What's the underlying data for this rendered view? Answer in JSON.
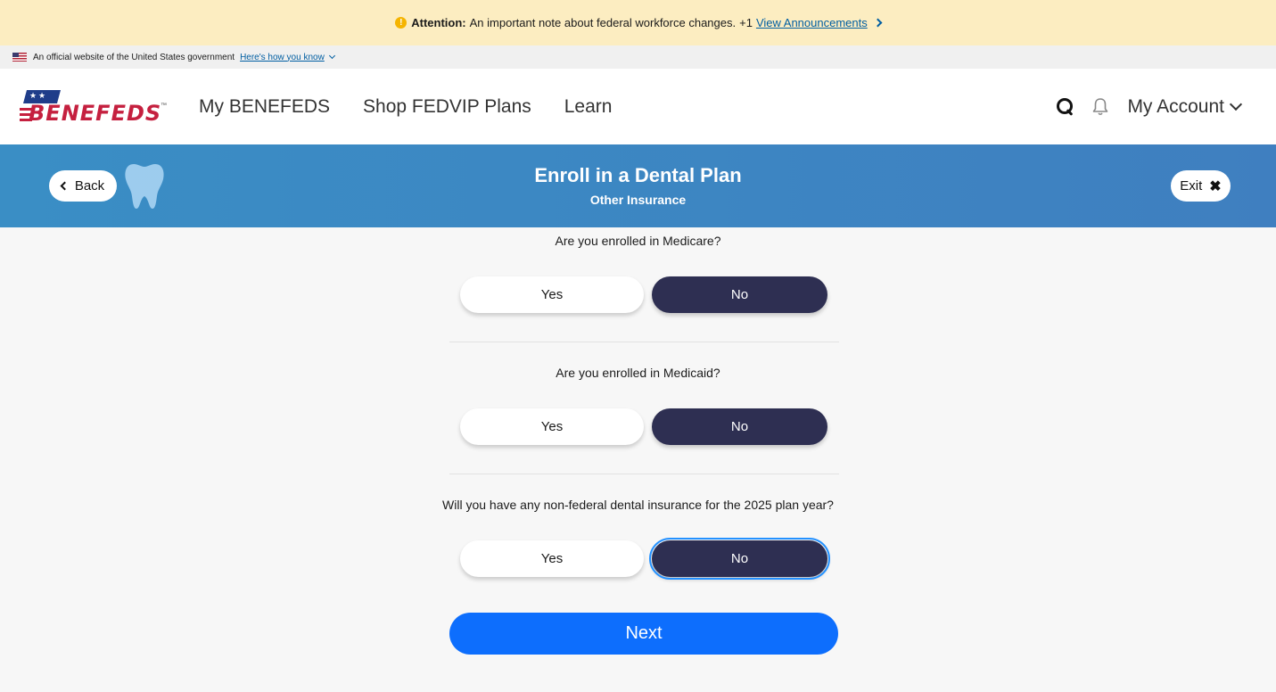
{
  "attention": {
    "label": "Attention:",
    "message": "An important note about federal workforce changes.",
    "count": "+1",
    "link_label": "View Announcements"
  },
  "gov_banner": {
    "text": "An official website of the United States government",
    "link_label": "Here's how you know"
  },
  "header": {
    "logo_text": "BENEFEDS",
    "nav": [
      "My BENEFEDS",
      "Shop FEDVIP Plans",
      "Learn"
    ],
    "account_label": "My Account"
  },
  "titlebar": {
    "back_label": "Back",
    "title": "Enroll in a Dental Plan",
    "subtitle": "Other Insurance",
    "exit_label": "Exit"
  },
  "questions": [
    {
      "text": "Are you enrolled in Medicare?",
      "yes": "Yes",
      "no": "No",
      "selected": "No"
    },
    {
      "text": "Are you enrolled in Medicaid?",
      "yes": "Yes",
      "no": "No",
      "selected": "No"
    },
    {
      "text": "Will you have any non-federal dental insurance for the 2025 plan year?",
      "yes": "Yes",
      "no": "No",
      "selected": "No"
    }
  ],
  "next_label": "Next",
  "colors": {
    "accent": "#0d6efd",
    "selected": "#2e2f52",
    "titlebar": "#3f87c3",
    "attention_bg": "#fcedc1"
  }
}
